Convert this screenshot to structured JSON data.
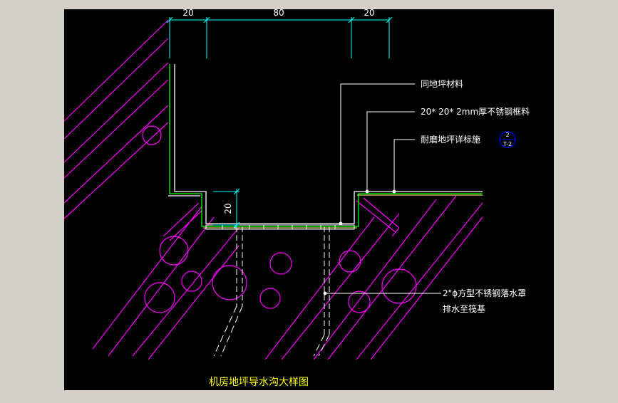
{
  "drawing": {
    "title": "机房地坪导水沟大样图",
    "dimensions": {
      "top_left": "20",
      "top_mid": "80",
      "top_right": "20",
      "side": "20"
    },
    "callouts": {
      "c1": "同地坪材料",
      "c2": "20* 20* 2mm厚不锈钢框料",
      "c3": "耐磨地坪详标施",
      "c4_line1": "2\"ϕ方型不锈钢落水罩",
      "c4_line2": "排水至筏基"
    },
    "section_mark": {
      "top": "2",
      "bottom": "T-2"
    }
  },
  "colors": {
    "bezel": "#d4d0c8",
    "canvas": "#000000",
    "dimension": "#00ffff",
    "outline": "#ffffff",
    "hatch": "#ff00ff",
    "finish": "#00ff00",
    "steel": "#ffff80",
    "title": "#ffff00",
    "symbol": "#0000ff"
  },
  "icons": [
    "callout-dot",
    "section-symbol"
  ]
}
